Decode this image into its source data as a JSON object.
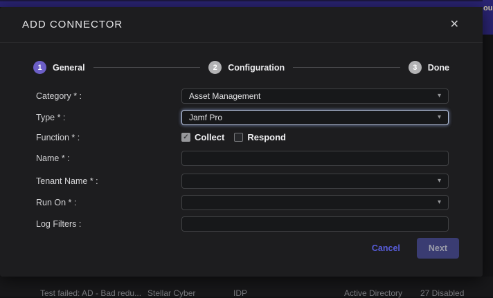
{
  "backdrop": {
    "topbar_fragment": "ou",
    "table_row": [
      "Test failed: AD - Bad redu...",
      "Stellar Cyber",
      "IDP",
      "Active Directory",
      "27 Disabled"
    ]
  },
  "modal": {
    "title": "ADD CONNECTOR",
    "close_icon": "✕",
    "steps": [
      {
        "number": "1",
        "label": "General"
      },
      {
        "number": "2",
        "label": "Configuration"
      },
      {
        "number": "3",
        "label": "Done"
      }
    ],
    "fields": {
      "category": {
        "label": "Category * :",
        "value": "Asset Management"
      },
      "type": {
        "label": "Type * :",
        "value": "Jamf Pro"
      },
      "function": {
        "label": "Function * :",
        "options": [
          {
            "label": "Collect",
            "checked": true
          },
          {
            "label": "Respond",
            "checked": false
          }
        ]
      },
      "name": {
        "label": "Name * :",
        "value": ""
      },
      "tenant": {
        "label": "Tenant Name * :",
        "value": ""
      },
      "run_on": {
        "label": "Run On * :",
        "value": ""
      },
      "log_filters": {
        "label": "Log Filters :",
        "value": ""
      }
    },
    "footer": {
      "cancel_label": "Cancel",
      "next_label": "Next"
    },
    "dropdown_caret": "▾"
  },
  "colors": {
    "accent_purple": "#6c5fc7",
    "cancel_link": "#575cd9",
    "next_button_bg": "#3a3c72",
    "topbar_navy": "#292371",
    "modal_bg": "#1d1d1f"
  }
}
